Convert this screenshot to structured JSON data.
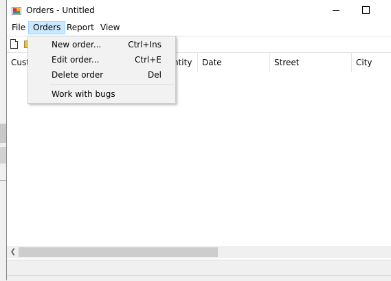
{
  "window": {
    "title": "Orders - Untitled"
  },
  "menubar": [
    "File",
    "Orders",
    "Report",
    "View"
  ],
  "orders_menu": {
    "items": [
      {
        "label": "New order...",
        "shortcut": "Ctrl+Ins"
      },
      {
        "label": "Edit order...",
        "shortcut": "Ctrl+E"
      },
      {
        "label": "Delete order",
        "shortcut": "Del"
      },
      {
        "label": "Work with bugs",
        "shortcut": ""
      }
    ]
  },
  "columns": [
    "Custo",
    "ntity",
    "Date",
    "Street",
    "City"
  ],
  "icons": {
    "app": "app-icon",
    "new": "new-document-icon",
    "open": "open-folder-icon",
    "minimize": "minimize-icon",
    "maximize": "maximize-icon",
    "scroll_left": "scroll-left-arrow-icon"
  },
  "colors": {
    "menu_active_bg": "#cce8ff",
    "menu_active_border": "#99d1ff"
  }
}
